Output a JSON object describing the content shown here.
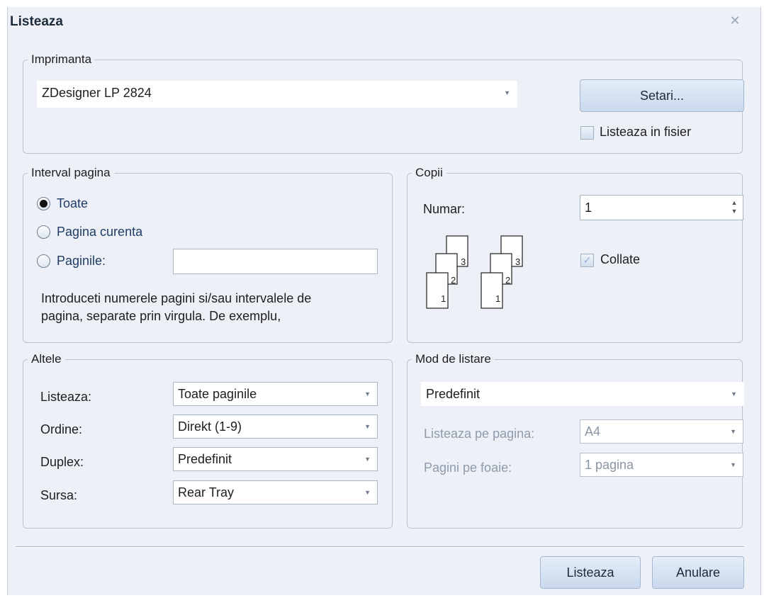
{
  "dialog": {
    "title": "Listeaza"
  },
  "printer": {
    "legend": "Imprimanta",
    "selected": "ZDesigner LP 2824",
    "settings_label": "Setari...",
    "print_to_file_label": "Listeaza in fisier"
  },
  "page_range": {
    "legend": "Interval pagina",
    "options": [
      "Toate",
      "Pagina curenta",
      "Paginile:"
    ],
    "selected_index": 0,
    "pages_value": "",
    "help_text_line1": "Introduceti numerele pagini si/sau intervalele de",
    "help_text_line2": "pagina, separate prin virgula. De exemplu,"
  },
  "copies": {
    "legend": "Copii",
    "number_label": "Numar:",
    "number_value": "1",
    "collate_label": "Collate",
    "collate_checked": true,
    "illustration_pages": [
      "1",
      "2",
      "3"
    ]
  },
  "other": {
    "legend": "Altele",
    "rows": [
      {
        "label": "Listeaza:",
        "value": "Toate paginile"
      },
      {
        "label": "Ordine:",
        "value": "Direkt (1-9)"
      },
      {
        "label": "Duplex:",
        "value": "Predefinit"
      },
      {
        "label": "Sursa:",
        "value": "Rear Tray"
      }
    ]
  },
  "print_mode": {
    "legend": "Mod de listare",
    "mode_value": "Predefinit",
    "page_size_label": "Listeaza pe pagina:",
    "page_size_value": "A4",
    "pages_per_sheet_label": "Pagini pe foaie:",
    "pages_per_sheet_value": "1 pagina"
  },
  "footer": {
    "print_label": "Listeaza",
    "cancel_label": "Anulare"
  },
  "colors": {
    "dialog_bg": "#edf1f7",
    "group_border": "#b6c3d3",
    "button_gradient_top": "#e4edf8",
    "button_gradient_bottom": "#c9d9ec"
  }
}
